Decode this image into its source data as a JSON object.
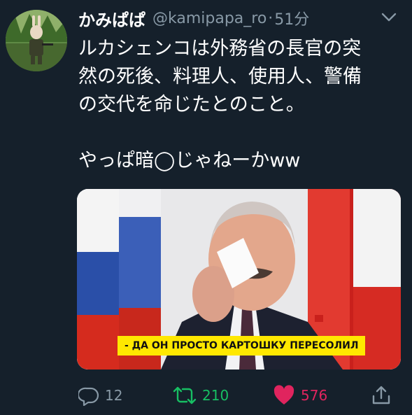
{
  "tweet": {
    "display_name": "かみぱぱ",
    "handle": "@kamipapa_ro",
    "separator": "·",
    "time": "51分",
    "text_lines": [
      "ルカシェンコは外務省の長官の突",
      "然の死後、料理人、使用人、警備",
      "の交代を命じたとのこと。",
      "やっぱ暗◯じゃねーかww"
    ]
  },
  "media": {
    "caption": "- ДА ОН ПРОСТО КАРТОШКУ ПЕРЕСОЛИЛ"
  },
  "actions": {
    "reply_count": "12",
    "retweet_count": "210",
    "like_count": "576"
  },
  "colors": {
    "background": "#15202b",
    "secondary_text": "#8899a6",
    "retweet_green": "#17bf63",
    "like_pink": "#e0245e",
    "caption_yellow": "#ffe800"
  },
  "icons": [
    "chevron-down-icon",
    "reply-icon",
    "retweet-icon",
    "heart-icon",
    "share-icon"
  ]
}
